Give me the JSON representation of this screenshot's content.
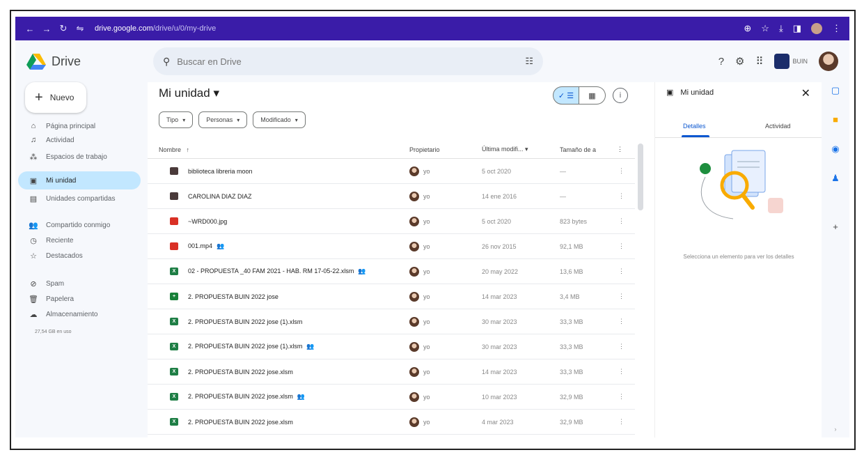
{
  "browser": {
    "url_host": "drive.google.com",
    "url_path": "/drive/u/0/my-drive",
    "icons": [
      "back-arrow",
      "forward-arrow",
      "reload",
      "site-settings",
      "extensions",
      "star",
      "download",
      "sidebar",
      "profile",
      "menu"
    ]
  },
  "header": {
    "app_name": "Drive",
    "search_placeholder": "Buscar en Drive",
    "org_label": "BUIN"
  },
  "sidebar": {
    "new_label": "Nuevo",
    "items": [
      {
        "label": "Página principal",
        "icon": "home-icon"
      },
      {
        "label": "Actividad",
        "icon": "bell-icon"
      },
      {
        "label": "Espacios de trabajo",
        "icon": "workspaces-icon"
      },
      {
        "label": "Mi unidad",
        "icon": "my-drive-icon"
      },
      {
        "label": "Unidades compartidas",
        "icon": "shared-drives-icon"
      },
      {
        "label": "Compartido conmigo",
        "icon": "people-icon"
      },
      {
        "label": "Reciente",
        "icon": "clock-icon"
      },
      {
        "label": "Destacados",
        "icon": "star-icon"
      },
      {
        "label": "Spam",
        "icon": "spam-icon"
      },
      {
        "label": "Papelera",
        "icon": "trash-icon"
      },
      {
        "label": "Almacenamiento",
        "icon": "cloud-icon"
      }
    ],
    "storage_text": "27,54 GB en uso"
  },
  "main": {
    "title": "Mi unidad",
    "filters": [
      "Tipo",
      "Personas",
      "Modificado"
    ],
    "columns": {
      "name": "Nombre",
      "owner": "Propietario",
      "modified": "Última modifi...",
      "size": "Tamaño de a"
    },
    "rows": [
      {
        "name": "biblioteca libreria moon",
        "type": "folder",
        "owner": "yo",
        "modified": "5 oct 2020",
        "size": "—",
        "shared": false
      },
      {
        "name": "CAROLINA DIAZ DIAZ",
        "type": "folder",
        "owner": "yo",
        "modified": "14 ene 2016",
        "size": "—",
        "shared": false
      },
      {
        "name": "~WRD000.jpg",
        "type": "image",
        "owner": "yo",
        "modified": "5 oct 2020",
        "size": "823 bytes",
        "shared": false
      },
      {
        "name": "001.mp4",
        "type": "video",
        "owner": "yo",
        "modified": "26 nov 2015",
        "size": "92,1 MB",
        "shared": true
      },
      {
        "name": "02 - PROPUESTA _40 FAM 2021 - HAB. RM 17-05-22.xlsm",
        "type": "excel",
        "owner": "yo",
        "modified": "20 may 2022",
        "size": "13,6 MB",
        "shared": true
      },
      {
        "name": "2. PROPUESTA BUIN 2022 jose",
        "type": "sheets",
        "owner": "yo",
        "modified": "14 mar 2023",
        "size": "3,4 MB",
        "shared": false
      },
      {
        "name": "2. PROPUESTA BUIN 2022 jose (1).xlsm",
        "type": "excel",
        "owner": "yo",
        "modified": "30 mar 2023",
        "size": "33,3 MB",
        "shared": false
      },
      {
        "name": "2. PROPUESTA BUIN 2022 jose (1).xlsm",
        "type": "excel",
        "owner": "yo",
        "modified": "30 mar 2023",
        "size": "33,3 MB",
        "shared": true
      },
      {
        "name": "2. PROPUESTA BUIN 2022 jose.xlsm",
        "type": "excel",
        "owner": "yo",
        "modified": "14 mar 2023",
        "size": "33,3 MB",
        "shared": false
      },
      {
        "name": "2. PROPUESTA BUIN 2022 jose.xlsm",
        "type": "excel",
        "owner": "yo",
        "modified": "10 mar 2023",
        "size": "32,9 MB",
        "shared": true
      },
      {
        "name": "2. PROPUESTA BUIN 2022 jose.xlsm",
        "type": "excel",
        "owner": "yo",
        "modified": "4 mar 2023",
        "size": "32,9 MB",
        "shared": false
      }
    ]
  },
  "details": {
    "title": "Mi unidad",
    "tab_details": "Detalles",
    "tab_activity": "Actividad",
    "empty_message": "Selecciona un elemento para ver los detalles"
  },
  "colors": {
    "browser_bar": "#3a1ca8",
    "active_nav": "#c2e7ff",
    "accent": "#0b57d0",
    "excel": "#1e7e45",
    "sheets": "#188038",
    "folder": "#4a3a3a",
    "image": "#d93025",
    "video": "#d93025"
  }
}
